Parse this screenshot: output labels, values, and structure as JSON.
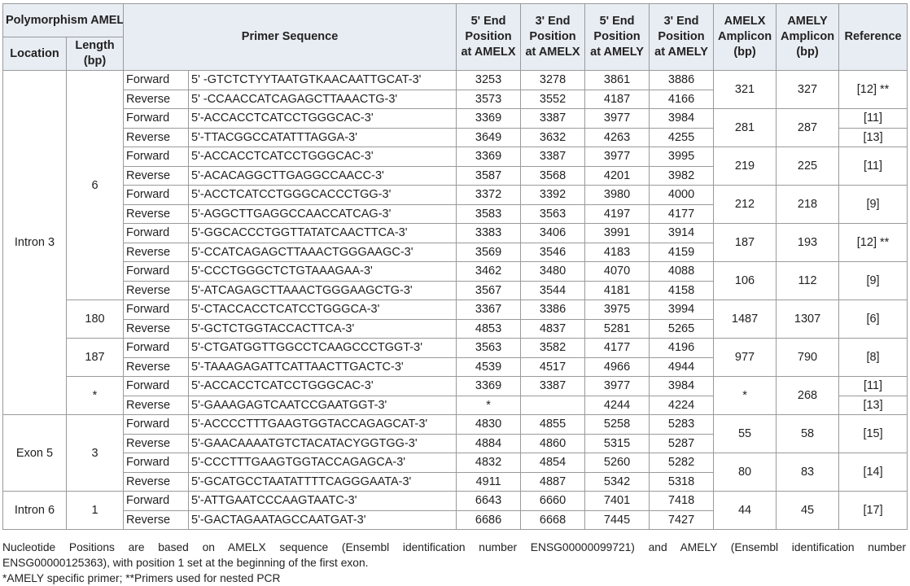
{
  "header": {
    "polymorphism": "Polymorphism AMELX and AMELY",
    "location": "Location",
    "length": "Length (bp)",
    "primer_sequence": "Primer Sequence",
    "end5_amelx": "5' End Position at AMELX",
    "end3_amelx": "3' End Position at AMELX",
    "end5_amely": "5' End Position at AMELY",
    "end3_amely": "3' End Position at AMELY",
    "amelx_amplicon": "AMELX Amplicon (bp)",
    "amely_amplicon": "AMELY Amplicon (bp)",
    "reference": "Reference"
  },
  "locations": {
    "intron3": "Intron 3",
    "exon5": "Exon 5",
    "intron6": "Intron 6"
  },
  "lengths": {
    "l6": "6",
    "l180": "180",
    "l187": "187",
    "lstar": "*",
    "l3": "3",
    "l1": "1"
  },
  "rows": [
    {
      "dir": "Forward",
      "seq": "5' -GTCTCTYYTAATGTKAACAATTGCAT-3'",
      "x5": "3253",
      "x3": "3278",
      "y5": "3861",
      "y3": "3886"
    },
    {
      "dir": "Reverse",
      "seq": "5' -CCAACCATCAGAGCTTAAACTG-3'",
      "x5": "3573",
      "x3": "3552",
      "y5": "4187",
      "y3": "4166"
    },
    {
      "dir": "Forward",
      "seq": "5'-ACCACCTCATCCTGGGCAC-3'",
      "x5": "3369",
      "x3": "3387",
      "y5": "3977",
      "y3": "3984"
    },
    {
      "dir": "Reverse",
      "seq": "5'-TTACGGCCATATTTAGGA-3'",
      "x5": "3649",
      "x3": "3632",
      "y5": "4263",
      "y3": "4255"
    },
    {
      "dir": "Forward",
      "seq": "5'-ACCACCTCATCCTGGGCAC-3'",
      "x5": "3369",
      "x3": "3387",
      "y5": "3977",
      "y3": "3995"
    },
    {
      "dir": "Reverse",
      "seq": "5'-ACACAGGCTTGAGGCCAACC-3'",
      "x5": "3587",
      "x3": "3568",
      "y5": "4201",
      "y3": "3982"
    },
    {
      "dir": "Forward",
      "seq": "5'-ACCTCATCCTGGGCACCCTGG-3'",
      "x5": "3372",
      "x3": "3392",
      "y5": "3980",
      "y3": "4000"
    },
    {
      "dir": "Reverse",
      "seq": "5'-AGGCTTGAGGCCAACCATCAG-3'",
      "x5": "3583",
      "x3": "3563",
      "y5": "4197",
      "y3": "4177"
    },
    {
      "dir": "Forward",
      "seq": "5'-GGCACCCTGGTTATATCAACTTCA-3'",
      "x5": "3383",
      "x3": "3406",
      "y5": "3991",
      "y3": "3914"
    },
    {
      "dir": "Reverse",
      "seq": "5'-CCATCAGAGCTTAAACTGGGAAGC-3'",
      "x5": "3569",
      "x3": "3546",
      "y5": "4183",
      "y3": "4159"
    },
    {
      "dir": "Forward",
      "seq": "5'-CCCTGGGCTCTGTAAAGAA-3'",
      "x5": "3462",
      "x3": "3480",
      "y5": "4070",
      "y3": "4088"
    },
    {
      "dir": "Reverse",
      "seq": "5'-ATCAGAGCTTAAACTGGGAAGCTG-3'",
      "x5": "3567",
      "x3": "3544",
      "y5": "4181",
      "y3": "4158"
    },
    {
      "dir": "Forward",
      "seq": "5'-CTACCACCTCATCCTGGGCA-3'",
      "x5": "3367",
      "x3": "3386",
      "y5": "3975",
      "y3": "3994"
    },
    {
      "dir": "Reverse",
      "seq": "5'-GCTCTGGTACCACTTCA-3'",
      "x5": "4853",
      "x3": "4837",
      "y5": "5281",
      "y3": "5265"
    },
    {
      "dir": "Forward",
      "seq": "5'-CTGATGGTTGGCCTCAAGCCCTGGT-3'",
      "x5": "3563",
      "x3": "3582",
      "y5": "4177",
      "y3": "4196"
    },
    {
      "dir": "Reverse",
      "seq": "5'-TAAAGAGATTCATTAACTTGACTC-3'",
      "x5": "4539",
      "x3": "4517",
      "y5": "4966",
      "y3": "4944"
    },
    {
      "dir": "Forward",
      "seq": "5'-ACCACCTCATCCTGGGCAC-3'",
      "x5": "3369",
      "x3": "3387",
      "y5": "3977",
      "y3": "3984"
    },
    {
      "dir": "Reverse",
      "seq": "5'-GAAAGAGTCAATCCGAATGGT-3'",
      "x5": "*",
      "x3": "",
      "y5": "4244",
      "y3": "4224"
    },
    {
      "dir": "Forward",
      "seq": "5'-ACCCCTTTGAAGTGGTACCAGAGCAT-3'",
      "x5": "4830",
      "x3": "4855",
      "y5": "5258",
      "y3": "5283"
    },
    {
      "dir": "Reverse",
      "seq": "5'-GAACAAAATGTCTACATACYGGTGG-3'",
      "x5": "4884",
      "x3": "4860",
      "y5": "5315",
      "y3": "5287"
    },
    {
      "dir": "Forward",
      "seq": "5'-CCCTTTGAAGTGGTACCAGAGCA-3'",
      "x5": "4832",
      "x3": "4854",
      "y5": "5260",
      "y3": "5282"
    },
    {
      "dir": "Reverse",
      "seq": "5'-GCATGCCTAATATTTTCAGGGAATA-3'",
      "x5": "4911",
      "x3": "4887",
      "y5": "5342",
      "y3": "5318"
    },
    {
      "dir": "Forward",
      "seq": "5'-ATTGAATCCCAAGTAATC-3'",
      "x5": "6643",
      "x3": "6660",
      "y5": "7401",
      "y3": "7418"
    },
    {
      "dir": "Reverse",
      "seq": "5'-GACTAGAATAGCCAATGAT-3'",
      "x5": "6686",
      "x3": "6668",
      "y5": "7445",
      "y3": "7427"
    }
  ],
  "amplicons": [
    {
      "x": "321",
      "y": "327",
      "ref": "[12] **"
    },
    {
      "x": "281",
      "y": "287",
      "ref_a": "[11]",
      "ref_b": "[13]"
    },
    {
      "x": "219",
      "y": "225",
      "ref": "[11]"
    },
    {
      "x": "212",
      "y": "218",
      "ref": "[9]"
    },
    {
      "x": "187",
      "y": "193",
      "ref": "[12] **"
    },
    {
      "x": "106",
      "y": "112",
      "ref": "[9]"
    },
    {
      "x": "1487",
      "y": "1307",
      "ref": "[6]"
    },
    {
      "x": "977",
      "y": "790",
      "ref": "[8]"
    },
    {
      "x": "*",
      "y": "268",
      "ref_a": "[11]",
      "ref_b": "[13]"
    },
    {
      "x": "55",
      "y": "58",
      "ref": "[15]"
    },
    {
      "x": "80",
      "y": "83",
      "ref": "[14]"
    },
    {
      "x": "44",
      "y": "45",
      "ref": "[17]"
    }
  ],
  "footnotes": {
    "line1": "Nucleotide Positions are based on AMELX sequence (Ensembl identification number ENSG00000099721) and AMELY (Ensembl identification number",
    "line2": "ENSG00000125363), with position 1 set at the beginning of the first exon.",
    "line3": "*AMELY specific primer; **Primers used for nested PCR"
  }
}
